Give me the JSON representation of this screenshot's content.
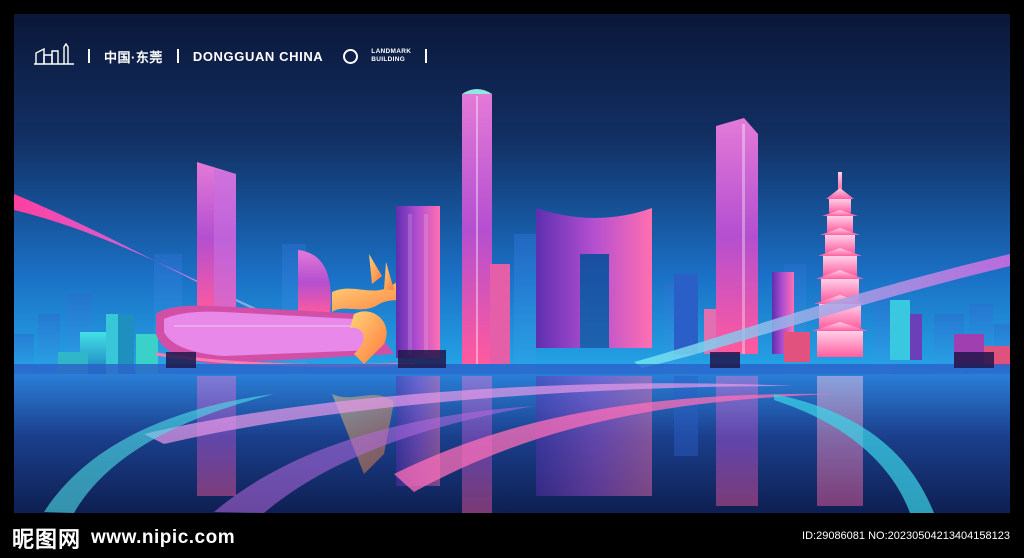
{
  "header": {
    "logo_icon": "city-skyline-icon",
    "city_cn": "中国·东莞",
    "city_en": "DONGGUAN CHINA",
    "landmark_line1": "LANDMARK",
    "landmark_line2": "BUILDING"
  },
  "watermark": {
    "site_cn": "昵图网",
    "site_url": "www.nipic.com",
    "id_text": "ID:29086081 NO:20230504213404158123"
  },
  "colors": {
    "sky_top": "#0c1a3e",
    "sky_bottom": "#1f7fd4",
    "pink": "#ff4fa8",
    "magenta": "#d03cc8",
    "cyan": "#3fe3e8",
    "orange": "#ff9a4a"
  }
}
